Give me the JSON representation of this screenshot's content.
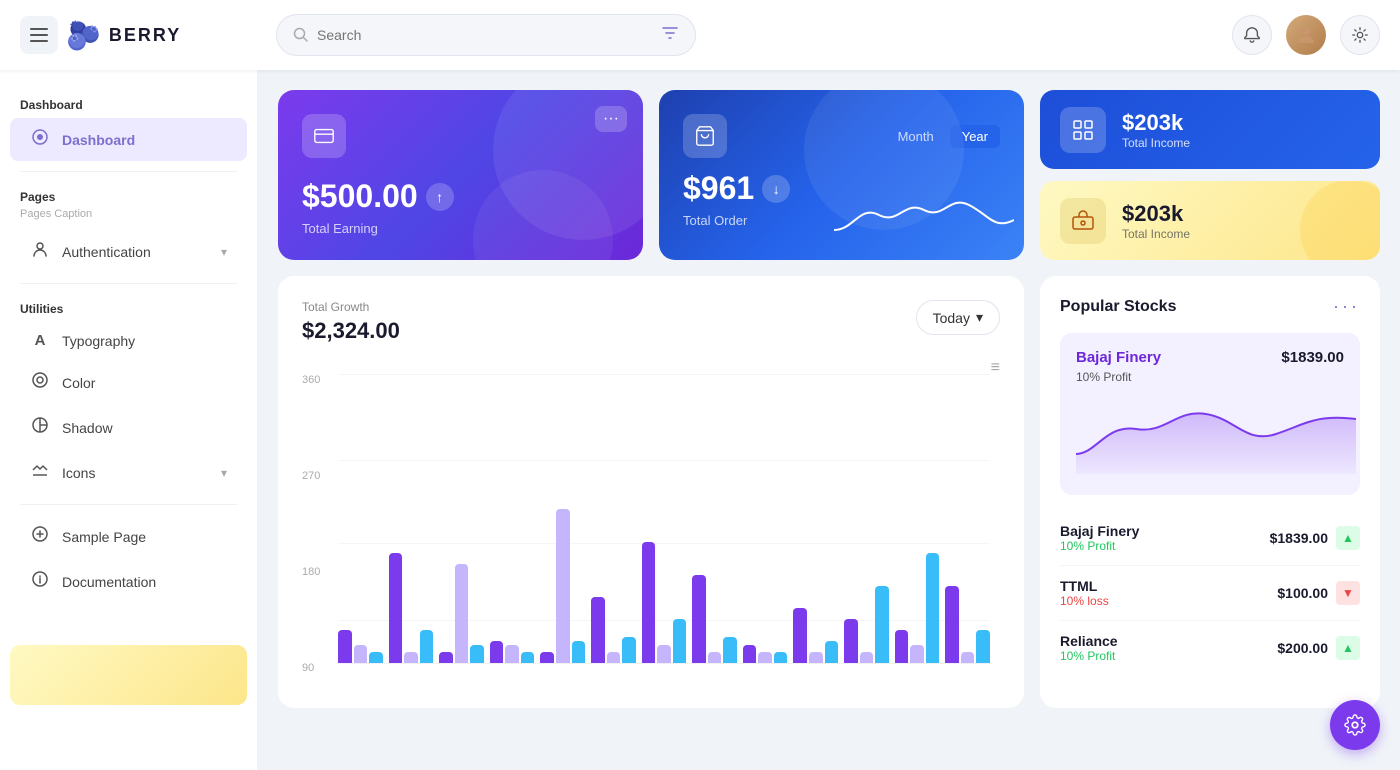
{
  "app": {
    "name": "BERRY",
    "logo_emoji": "🫐"
  },
  "header": {
    "search_placeholder": "Search",
    "hamburger_label": "☰",
    "filter_icon": "⊞",
    "notification_icon": "🔔",
    "settings_icon": "⚙",
    "avatar_emoji": "👤"
  },
  "sidebar": {
    "sections": [
      {
        "label": "Dashboard",
        "items": [
          {
            "id": "dashboard",
            "icon": "⊙",
            "label": "Dashboard",
            "active": true
          }
        ]
      },
      {
        "label": "Pages",
        "caption": "Pages Caption",
        "items": [
          {
            "id": "authentication",
            "icon": "🔑",
            "label": "Authentication",
            "chevron": true
          }
        ]
      },
      {
        "label": "Utilities",
        "items": [
          {
            "id": "typography",
            "icon": "A",
            "label": "Typography"
          },
          {
            "id": "color",
            "icon": "◎",
            "label": "Color"
          },
          {
            "id": "shadow",
            "icon": "⊕",
            "label": "Shadow"
          },
          {
            "id": "icons",
            "icon": "✦",
            "label": "Icons",
            "chevron": true
          }
        ]
      },
      {
        "label": "",
        "items": [
          {
            "id": "sample-page",
            "icon": "◎",
            "label": "Sample Page"
          },
          {
            "id": "documentation",
            "icon": "?",
            "label": "Documentation"
          }
        ]
      }
    ]
  },
  "cards": {
    "earning": {
      "icon": "💳",
      "amount": "$500.00",
      "label": "Total Earning",
      "trend": "↑"
    },
    "order": {
      "icon": "🛍",
      "amount": "$961",
      "label": "Total Order",
      "trend": "↓",
      "toggle_month": "Month",
      "toggle_year": "Year"
    },
    "total_income_blue": {
      "icon": "📋",
      "amount": "$203k",
      "label": "Total Income"
    },
    "total_income_yellow": {
      "icon": "🏦",
      "amount": "$203k",
      "label": "Total Income"
    }
  },
  "chart": {
    "title": "Total Growth",
    "amount": "$2,324.00",
    "filter_btn": "Today",
    "y_labels": [
      "360",
      "270",
      "180",
      "90"
    ],
    "bars": [
      {
        "h_purple": 15,
        "h_light": 8,
        "h_cyan": 5
      },
      {
        "h_purple": 50,
        "h_light": 5,
        "h_cyan": 15
      },
      {
        "h_purple": 5,
        "h_light": 45,
        "h_cyan": 8
      },
      {
        "h_purple": 10,
        "h_light": 8,
        "h_cyan": 5
      },
      {
        "h_purple": 5,
        "h_light": 70,
        "h_cyan": 10
      },
      {
        "h_purple": 30,
        "h_light": 5,
        "h_cyan": 12
      },
      {
        "h_purple": 55,
        "h_light": 8,
        "h_cyan": 20
      },
      {
        "h_purple": 40,
        "h_light": 5,
        "h_cyan": 12
      },
      {
        "h_purple": 8,
        "h_light": 5,
        "h_cyan": 5
      },
      {
        "h_purple": 25,
        "h_light": 5,
        "h_cyan": 10
      },
      {
        "h_purple": 20,
        "h_light": 5,
        "h_cyan": 35
      },
      {
        "h_purple": 15,
        "h_light": 8,
        "h_cyan": 50
      },
      {
        "h_purple": 35,
        "h_light": 5,
        "h_cyan": 15
      }
    ]
  },
  "stocks": {
    "title": "Popular Stocks",
    "menu_icon": "···",
    "featured": {
      "name": "Bajaj Finery",
      "price": "$1839.00",
      "profit_label": "10% Profit"
    },
    "rows": [
      {
        "name": "Bajaj Finery",
        "sub": "10% Profit",
        "sub_type": "profit",
        "price": "$1839.00",
        "trend": "up"
      },
      {
        "name": "TTML",
        "sub": "10% loss",
        "sub_type": "loss",
        "price": "$100.00",
        "trend": "down"
      },
      {
        "name": "Reliance",
        "sub": "10% Profit",
        "sub_type": "profit",
        "price": "$200.00",
        "trend": "up"
      }
    ]
  },
  "fab": {
    "icon": "⚙",
    "label": "Settings FAB"
  }
}
